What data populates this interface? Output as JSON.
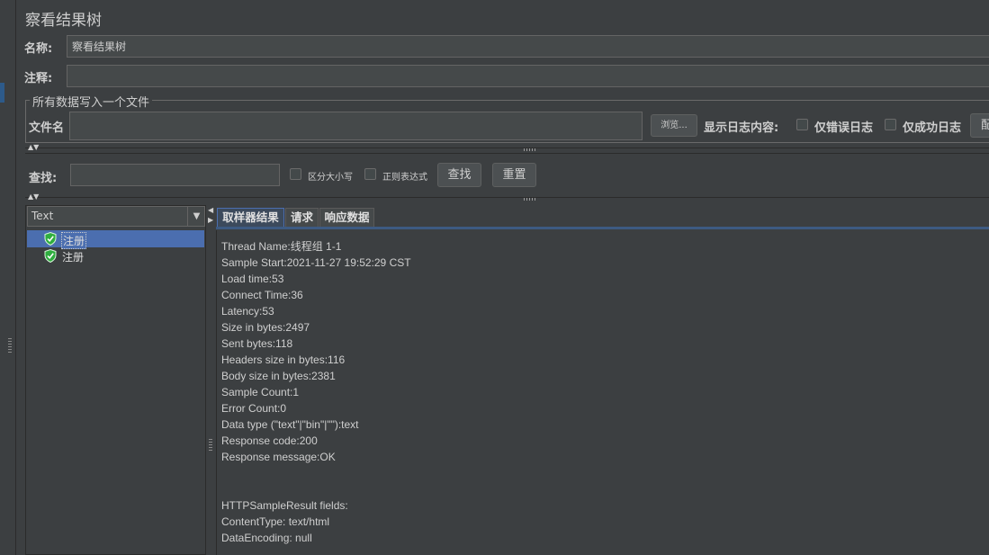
{
  "title": "察看结果树",
  "name_label": "名称:",
  "name_value": "察看结果树",
  "comment_label": "注释:",
  "comment_value": "",
  "file_group": {
    "title": "所有数据写入一个文件",
    "file_label": "文件名",
    "file_value": "",
    "browse_label": "浏览...",
    "log_label": "显示日志内容:",
    "errors_only_label": "仅错误日志",
    "success_only_label": "仅成功日志",
    "config_label": "配"
  },
  "search": {
    "label": "查找:",
    "value": "",
    "case_label": "区分大小写",
    "regex_label": "正则表达式",
    "find_label": "查找",
    "reset_label": "重置"
  },
  "tree": {
    "renderer": "Text",
    "items": [
      {
        "label": "注册",
        "status": "success",
        "selected": true
      },
      {
        "label": "注册",
        "status": "success",
        "selected": false
      }
    ]
  },
  "tabs": [
    {
      "label": "取样器结果",
      "active": true
    },
    {
      "label": "请求",
      "active": false
    },
    {
      "label": "响应数据",
      "active": false
    }
  ],
  "result_lines": [
    "Thread Name:线程组 1-1",
    "Sample Start:2021-11-27 19:52:29 CST",
    "Load time:53",
    "Connect Time:36",
    "Latency:53",
    "Size in bytes:2497",
    "Sent bytes:118",
    "Headers size in bytes:116",
    "Body size in bytes:2381",
    "Sample Count:1",
    "Error Count:0",
    "Data type (\"text\"|\"bin\"|\"\"):text",
    "Response code:200",
    "Response message:OK",
    "",
    "",
    "HTTPSampleResult fields:",
    "ContentType: text/html",
    "DataEncoding: null"
  ],
  "colors": {
    "background": "#3c3f41",
    "selection": "#4b6eaf",
    "success_icon": "#2fae3f"
  }
}
